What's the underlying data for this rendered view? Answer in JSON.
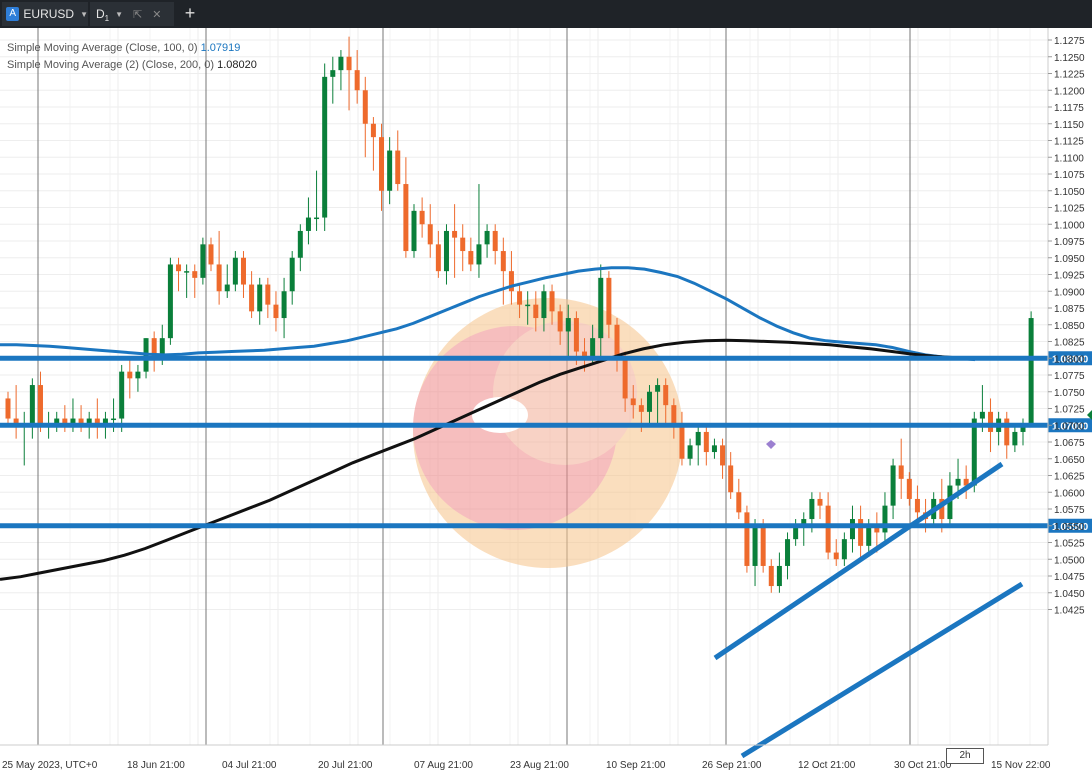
{
  "tabs": {
    "symbol": "EURUSD",
    "symbol_icon": "A",
    "timeframe": "D",
    "timeframe_sub": "1"
  },
  "legend": {
    "sma1_label": "Simple Moving Average (Close, 100, 0)",
    "sma1_value": "1.07919",
    "sma2_label": "Simple Moving Average (2) (Close, 200, 0)",
    "sma2_value": "1.08020"
  },
  "scroll_tag": "2h",
  "colors": {
    "bull": "#0a7f3a",
    "bear": "#ee6a2c",
    "sma100": "#1b76c0",
    "sma200": "#111111",
    "level_line": "#1b76c0",
    "level_badge": "#1b76c0"
  },
  "chart_data": {
    "type": "candlestick",
    "y_ticks": [
      "1.1275",
      "1.1250",
      "1.1225",
      "1.1200",
      "1.1175",
      "1.1150",
      "1.1125",
      "1.1100",
      "1.1075",
      "1.1050",
      "1.1025",
      "1.1000",
      "1.0975",
      "1.0950",
      "1.0925",
      "1.0900",
      "1.0875",
      "1.0850",
      "1.0825",
      "1.0800",
      "1.0775",
      "1.0750",
      "1.0725",
      "1.0700",
      "1.0675",
      "1.0650",
      "1.0625",
      "1.0600",
      "1.0575",
      "1.0550",
      "1.0525",
      "1.0500",
      "1.0475",
      "1.0450",
      "1.0425"
    ],
    "ylim": [
      1.0418,
      1.1286
    ],
    "x_labels": [
      "25 May 2023, UTC+0",
      "18 Jun 21:00",
      "04 Jul 21:00",
      "20 Jul 21:00",
      "07 Aug 21:00",
      "23 Aug 21:00",
      "10 Sep 21:00",
      "26 Sep 21:00",
      "12 Oct 21:00",
      "30 Oct 21:00",
      "15 Nov 22:00"
    ],
    "horizontal_levels": [
      "1.08000",
      "1.07000",
      "1.05500"
    ],
    "ohlc": [
      [
        1.074,
        1.075,
        1.07,
        1.071
      ],
      [
        1.071,
        1.076,
        1.068,
        1.07
      ],
      [
        1.07,
        1.072,
        1.064,
        1.07
      ],
      [
        1.07,
        1.077,
        1.068,
        1.076
      ],
      [
        1.076,
        1.078,
        1.069,
        1.07
      ],
      [
        1.07,
        1.072,
        1.068,
        1.07
      ],
      [
        1.07,
        1.072,
        1.069,
        1.071
      ],
      [
        1.071,
        1.073,
        1.069,
        1.07
      ],
      [
        1.07,
        1.074,
        1.069,
        1.071
      ],
      [
        1.071,
        1.073,
        1.069,
        1.07
      ],
      [
        1.07,
        1.072,
        1.068,
        1.071
      ],
      [
        1.071,
        1.074,
        1.068,
        1.07
      ],
      [
        1.07,
        1.072,
        1.068,
        1.071
      ],
      [
        1.071,
        1.074,
        1.069,
        1.071
      ],
      [
        1.071,
        1.079,
        1.069,
        1.078
      ],
      [
        1.078,
        1.08,
        1.074,
        1.077
      ],
      [
        1.077,
        1.079,
        1.075,
        1.078
      ],
      [
        1.078,
        1.083,
        1.077,
        1.083
      ],
      [
        1.083,
        1.084,
        1.078,
        1.08
      ],
      [
        1.08,
        1.085,
        1.079,
        1.083
      ],
      [
        1.083,
        1.095,
        1.082,
        1.094
      ],
      [
        1.094,
        1.095,
        1.09,
        1.093
      ],
      [
        1.093,
        1.094,
        1.089,
        1.093
      ],
      [
        1.093,
        1.094,
        1.089,
        1.092
      ],
      [
        1.092,
        1.098,
        1.091,
        1.097
      ],
      [
        1.097,
        1.098,
        1.093,
        1.094
      ],
      [
        1.094,
        1.099,
        1.088,
        1.09
      ],
      [
        1.09,
        1.094,
        1.089,
        1.091
      ],
      [
        1.091,
        1.096,
        1.09,
        1.095
      ],
      [
        1.095,
        1.096,
        1.089,
        1.091
      ],
      [
        1.091,
        1.093,
        1.086,
        1.087
      ],
      [
        1.087,
        1.092,
        1.085,
        1.091
      ],
      [
        1.091,
        1.092,
        1.086,
        1.088
      ],
      [
        1.088,
        1.09,
        1.084,
        1.086
      ],
      [
        1.086,
        1.092,
        1.083,
        1.09
      ],
      [
        1.09,
        1.096,
        1.088,
        1.095
      ],
      [
        1.095,
        1.1,
        1.093,
        1.099
      ],
      [
        1.099,
        1.104,
        1.097,
        1.101
      ],
      [
        1.101,
        1.108,
        1.099,
        1.101
      ],
      [
        1.101,
        1.124,
        1.099,
        1.122
      ],
      [
        1.122,
        1.125,
        1.118,
        1.123
      ],
      [
        1.123,
        1.126,
        1.12,
        1.125
      ],
      [
        1.125,
        1.128,
        1.117,
        1.123
      ],
      [
        1.123,
        1.126,
        1.118,
        1.12
      ],
      [
        1.12,
        1.122,
        1.11,
        1.115
      ],
      [
        1.115,
        1.116,
        1.108,
        1.113
      ],
      [
        1.113,
        1.115,
        1.102,
        1.105
      ],
      [
        1.105,
        1.113,
        1.103,
        1.111
      ],
      [
        1.111,
        1.114,
        1.105,
        1.106
      ],
      [
        1.106,
        1.11,
        1.095,
        1.096
      ],
      [
        1.096,
        1.103,
        1.095,
        1.102
      ],
      [
        1.102,
        1.104,
        1.098,
        1.1
      ],
      [
        1.1,
        1.103,
        1.095,
        1.097
      ],
      [
        1.097,
        1.099,
        1.092,
        1.093
      ],
      [
        1.093,
        1.1,
        1.091,
        1.099
      ],
      [
        1.099,
        1.103,
        1.092,
        1.098
      ],
      [
        1.098,
        1.1,
        1.093,
        1.096
      ],
      [
        1.096,
        1.098,
        1.093,
        1.094
      ],
      [
        1.094,
        1.106,
        1.092,
        1.097
      ],
      [
        1.097,
        1.1,
        1.095,
        1.099
      ],
      [
        1.099,
        1.1,
        1.094,
        1.096
      ],
      [
        1.096,
        1.098,
        1.088,
        1.093
      ],
      [
        1.093,
        1.096,
        1.088,
        1.09
      ],
      [
        1.09,
        1.091,
        1.086,
        1.088
      ],
      [
        1.088,
        1.09,
        1.085,
        1.088
      ],
      [
        1.088,
        1.09,
        1.084,
        1.086
      ],
      [
        1.086,
        1.091,
        1.084,
        1.09
      ],
      [
        1.09,
        1.091,
        1.085,
        1.087
      ],
      [
        1.087,
        1.088,
        1.082,
        1.084
      ],
      [
        1.084,
        1.088,
        1.08,
        1.086
      ],
      [
        1.086,
        1.087,
        1.079,
        1.081
      ],
      [
        1.081,
        1.083,
        1.078,
        1.08
      ],
      [
        1.08,
        1.085,
        1.079,
        1.083
      ],
      [
        1.083,
        1.094,
        1.08,
        1.092
      ],
      [
        1.092,
        1.093,
        1.083,
        1.085
      ],
      [
        1.085,
        1.086,
        1.078,
        1.08
      ],
      [
        1.08,
        1.081,
        1.072,
        1.074
      ],
      [
        1.074,
        1.076,
        1.071,
        1.073
      ],
      [
        1.073,
        1.074,
        1.069,
        1.072
      ],
      [
        1.072,
        1.076,
        1.07,
        1.075
      ],
      [
        1.075,
        1.077,
        1.07,
        1.076
      ],
      [
        1.076,
        1.077,
        1.07,
        1.073
      ],
      [
        1.073,
        1.074,
        1.068,
        1.07
      ],
      [
        1.07,
        1.072,
        1.064,
        1.065
      ],
      [
        1.065,
        1.068,
        1.064,
        1.067
      ],
      [
        1.067,
        1.07,
        1.064,
        1.069
      ],
      [
        1.069,
        1.07,
        1.064,
        1.066
      ],
      [
        1.066,
        1.068,
        1.065,
        1.067
      ],
      [
        1.067,
        1.068,
        1.062,
        1.064
      ],
      [
        1.064,
        1.066,
        1.059,
        1.06
      ],
      [
        1.06,
        1.062,
        1.056,
        1.057
      ],
      [
        1.057,
        1.058,
        1.048,
        1.049
      ],
      [
        1.049,
        1.056,
        1.046,
        1.055
      ],
      [
        1.055,
        1.056,
        1.048,
        1.049
      ],
      [
        1.049,
        1.05,
        1.045,
        1.046
      ],
      [
        1.046,
        1.051,
        1.045,
        1.049
      ],
      [
        1.049,
        1.054,
        1.047,
        1.053
      ],
      [
        1.053,
        1.056,
        1.052,
        1.055
      ],
      [
        1.055,
        1.057,
        1.052,
        1.056
      ],
      [
        1.056,
        1.06,
        1.054,
        1.059
      ],
      [
        1.059,
        1.06,
        1.056,
        1.058
      ],
      [
        1.058,
        1.06,
        1.05,
        1.051
      ],
      [
        1.051,
        1.053,
        1.049,
        1.05
      ],
      [
        1.05,
        1.054,
        1.049,
        1.053
      ],
      [
        1.053,
        1.058,
        1.051,
        1.056
      ],
      [
        1.056,
        1.058,
        1.05,
        1.052
      ],
      [
        1.052,
        1.056,
        1.051,
        1.055
      ],
      [
        1.055,
        1.057,
        1.051,
        1.054
      ],
      [
        1.054,
        1.06,
        1.052,
        1.058
      ],
      [
        1.058,
        1.065,
        1.056,
        1.064
      ],
      [
        1.064,
        1.068,
        1.059,
        1.062
      ],
      [
        1.062,
        1.063,
        1.058,
        1.059
      ],
      [
        1.059,
        1.061,
        1.056,
        1.057
      ],
      [
        1.057,
        1.059,
        1.054,
        1.056
      ],
      [
        1.056,
        1.06,
        1.055,
        1.059
      ],
      [
        1.059,
        1.062,
        1.054,
        1.056
      ],
      [
        1.056,
        1.063,
        1.055,
        1.061
      ],
      [
        1.061,
        1.065,
        1.059,
        1.062
      ],
      [
        1.062,
        1.064,
        1.059,
        1.061
      ],
      [
        1.061,
        1.072,
        1.06,
        1.071
      ],
      [
        1.071,
        1.076,
        1.069,
        1.072
      ],
      [
        1.072,
        1.074,
        1.066,
        1.069
      ],
      [
        1.069,
        1.072,
        1.067,
        1.071
      ],
      [
        1.071,
        1.072,
        1.065,
        1.067
      ],
      [
        1.067,
        1.07,
        1.066,
        1.069
      ],
      [
        1.069,
        1.071,
        1.067,
        1.07
      ],
      [
        1.07,
        1.087,
        1.07,
        1.086
      ]
    ],
    "sma100": [
      1.082,
      1.082,
      1.0819,
      1.0818,
      1.0816,
      1.0814,
      1.0812,
      1.081,
      1.0808,
      1.0806,
      1.0805,
      1.0806,
      1.0808,
      1.0809,
      1.081,
      1.0811,
      1.0812,
      1.0814,
      1.0816,
      1.0818,
      1.0822,
      1.0826,
      1.0832,
      1.0838,
      1.0844,
      1.0852,
      1.0862,
      1.0872,
      1.0882,
      1.0892,
      1.09,
      1.0908,
      1.0914,
      1.092,
      1.0925,
      1.093,
      1.0933,
      1.0935,
      1.0935,
      1.0933,
      1.0928,
      1.0922,
      1.0912,
      1.09,
      1.0888,
      1.0874,
      1.086,
      1.0848,
      1.0838,
      1.083,
      1.0826,
      1.0824,
      1.0822,
      1.082,
      1.0816,
      1.081,
      1.0805,
      1.0802,
      1.08,
      1.0798
    ],
    "sma200": [
      1.047,
      1.0474,
      1.048,
      1.0486,
      1.0492,
      1.0498,
      1.0506,
      1.0516,
      1.0528,
      1.054,
      1.0552,
      1.0564,
      1.0576,
      1.0588,
      1.0602,
      1.0616,
      1.063,
      1.0644,
      1.0656,
      1.0668,
      1.068,
      1.0694,
      1.0708,
      1.0722,
      1.0736,
      1.075,
      1.0764,
      1.0776,
      1.0786,
      1.0796,
      1.0806,
      1.0814,
      1.082,
      1.0824,
      1.0826,
      1.0827,
      1.0826,
      1.0825,
      1.0824,
      1.0822,
      1.082,
      1.0817,
      1.0814,
      1.081,
      1.0806,
      1.0803,
      1.0801,
      1.08
    ]
  }
}
